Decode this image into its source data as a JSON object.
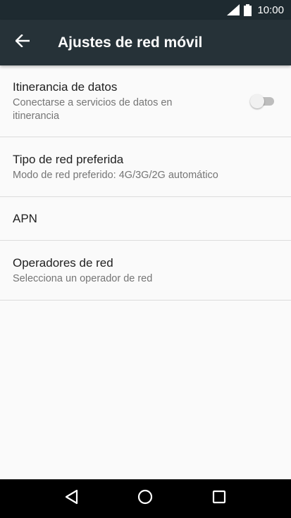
{
  "status_bar": {
    "time": "10:00",
    "icons": [
      "signal-icon",
      "battery-icon"
    ]
  },
  "toolbar": {
    "back_icon": "arrow-back-icon",
    "title": "Ajustes de red móvil"
  },
  "settings": {
    "roaming": {
      "title": "Itinerancia de datos",
      "summary": "Conectarse a servicios de datos en itinerancia",
      "toggle_on": false
    },
    "network_type": {
      "title": "Tipo de red preferida",
      "summary": "Modo de red preferido: 4G/3G/2G automático"
    },
    "apn": {
      "title": "APN"
    },
    "operators": {
      "title": "Operadores de red",
      "summary": "Selecciona un operador de red"
    }
  },
  "nav_bar": {
    "buttons": [
      "back-triangle-icon",
      "home-circle-icon",
      "recents-square-icon"
    ]
  },
  "colors": {
    "status_bar": "#1e2a30",
    "toolbar": "#263238",
    "background": "#fafafa",
    "nav_bar": "#000000"
  }
}
